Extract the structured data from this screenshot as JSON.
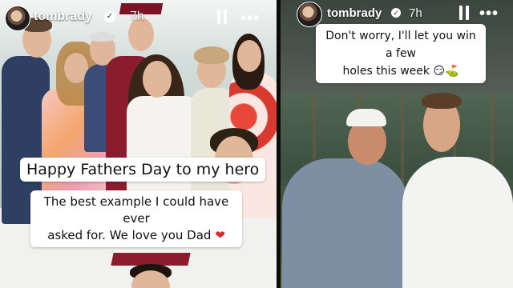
{
  "left_story": {
    "username": "tombrady",
    "time": "7h",
    "more_label": "•••",
    "caption_title": "Happy Fathers Day to my hero",
    "caption_body_line1": "The best example I could have ever",
    "caption_body_line2": "asked for. We love you Dad",
    "caption_emoji": "❤"
  },
  "right_story": {
    "username": "tombrady",
    "time": "7h",
    "more_label": "•••",
    "caption_line1": "Don't worry, I'll let you win a few",
    "caption_line2": "holes this week",
    "caption_emoji": "😏⛳"
  },
  "icons": [
    "avatar",
    "verified-badge-icon",
    "pause-icon",
    "more-icon",
    "heart-icon"
  ],
  "colors": {
    "heart": "#e2242d",
    "text_white": "#ffffff"
  }
}
